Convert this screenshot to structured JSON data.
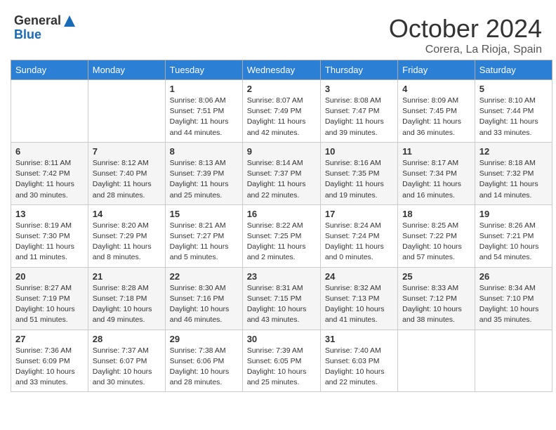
{
  "logo": {
    "general": "General",
    "blue": "Blue"
  },
  "header": {
    "month": "October 2024",
    "location": "Corera, La Rioja, Spain"
  },
  "weekdays": [
    "Sunday",
    "Monday",
    "Tuesday",
    "Wednesday",
    "Thursday",
    "Friday",
    "Saturday"
  ],
  "weeks": [
    [
      null,
      null,
      {
        "day": 1,
        "sunrise": "8:06 AM",
        "sunset": "7:51 PM",
        "daylight": "11 hours and 44 minutes."
      },
      {
        "day": 2,
        "sunrise": "8:07 AM",
        "sunset": "7:49 PM",
        "daylight": "11 hours and 42 minutes."
      },
      {
        "day": 3,
        "sunrise": "8:08 AM",
        "sunset": "7:47 PM",
        "daylight": "11 hours and 39 minutes."
      },
      {
        "day": 4,
        "sunrise": "8:09 AM",
        "sunset": "7:45 PM",
        "daylight": "11 hours and 36 minutes."
      },
      {
        "day": 5,
        "sunrise": "8:10 AM",
        "sunset": "7:44 PM",
        "daylight": "11 hours and 33 minutes."
      }
    ],
    [
      {
        "day": 6,
        "sunrise": "8:11 AM",
        "sunset": "7:42 PM",
        "daylight": "11 hours and 30 minutes."
      },
      {
        "day": 7,
        "sunrise": "8:12 AM",
        "sunset": "7:40 PM",
        "daylight": "11 hours and 28 minutes."
      },
      {
        "day": 8,
        "sunrise": "8:13 AM",
        "sunset": "7:39 PM",
        "daylight": "11 hours and 25 minutes."
      },
      {
        "day": 9,
        "sunrise": "8:14 AM",
        "sunset": "7:37 PM",
        "daylight": "11 hours and 22 minutes."
      },
      {
        "day": 10,
        "sunrise": "8:16 AM",
        "sunset": "7:35 PM",
        "daylight": "11 hours and 19 minutes."
      },
      {
        "day": 11,
        "sunrise": "8:17 AM",
        "sunset": "7:34 PM",
        "daylight": "11 hours and 16 minutes."
      },
      {
        "day": 12,
        "sunrise": "8:18 AM",
        "sunset": "7:32 PM",
        "daylight": "11 hours and 14 minutes."
      }
    ],
    [
      {
        "day": 13,
        "sunrise": "8:19 AM",
        "sunset": "7:30 PM",
        "daylight": "11 hours and 11 minutes."
      },
      {
        "day": 14,
        "sunrise": "8:20 AM",
        "sunset": "7:29 PM",
        "daylight": "11 hours and 8 minutes."
      },
      {
        "day": 15,
        "sunrise": "8:21 AM",
        "sunset": "7:27 PM",
        "daylight": "11 hours and 5 minutes."
      },
      {
        "day": 16,
        "sunrise": "8:22 AM",
        "sunset": "7:25 PM",
        "daylight": "11 hours and 2 minutes."
      },
      {
        "day": 17,
        "sunrise": "8:24 AM",
        "sunset": "7:24 PM",
        "daylight": "11 hours and 0 minutes."
      },
      {
        "day": 18,
        "sunrise": "8:25 AM",
        "sunset": "7:22 PM",
        "daylight": "10 hours and 57 minutes."
      },
      {
        "day": 19,
        "sunrise": "8:26 AM",
        "sunset": "7:21 PM",
        "daylight": "10 hours and 54 minutes."
      }
    ],
    [
      {
        "day": 20,
        "sunrise": "8:27 AM",
        "sunset": "7:19 PM",
        "daylight": "10 hours and 51 minutes."
      },
      {
        "day": 21,
        "sunrise": "8:28 AM",
        "sunset": "7:18 PM",
        "daylight": "10 hours and 49 minutes."
      },
      {
        "day": 22,
        "sunrise": "8:30 AM",
        "sunset": "7:16 PM",
        "daylight": "10 hours and 46 minutes."
      },
      {
        "day": 23,
        "sunrise": "8:31 AM",
        "sunset": "7:15 PM",
        "daylight": "10 hours and 43 minutes."
      },
      {
        "day": 24,
        "sunrise": "8:32 AM",
        "sunset": "7:13 PM",
        "daylight": "10 hours and 41 minutes."
      },
      {
        "day": 25,
        "sunrise": "8:33 AM",
        "sunset": "7:12 PM",
        "daylight": "10 hours and 38 minutes."
      },
      {
        "day": 26,
        "sunrise": "8:34 AM",
        "sunset": "7:10 PM",
        "daylight": "10 hours and 35 minutes."
      }
    ],
    [
      {
        "day": 27,
        "sunrise": "7:36 AM",
        "sunset": "6:09 PM",
        "daylight": "10 hours and 33 minutes."
      },
      {
        "day": 28,
        "sunrise": "7:37 AM",
        "sunset": "6:07 PM",
        "daylight": "10 hours and 30 minutes."
      },
      {
        "day": 29,
        "sunrise": "7:38 AM",
        "sunset": "6:06 PM",
        "daylight": "10 hours and 28 minutes."
      },
      {
        "day": 30,
        "sunrise": "7:39 AM",
        "sunset": "6:05 PM",
        "daylight": "10 hours and 25 minutes."
      },
      {
        "day": 31,
        "sunrise": "7:40 AM",
        "sunset": "6:03 PM",
        "daylight": "10 hours and 22 minutes."
      },
      null,
      null
    ]
  ],
  "labels": {
    "sunrise": "Sunrise:",
    "sunset": "Sunset:",
    "daylight": "Daylight:"
  }
}
